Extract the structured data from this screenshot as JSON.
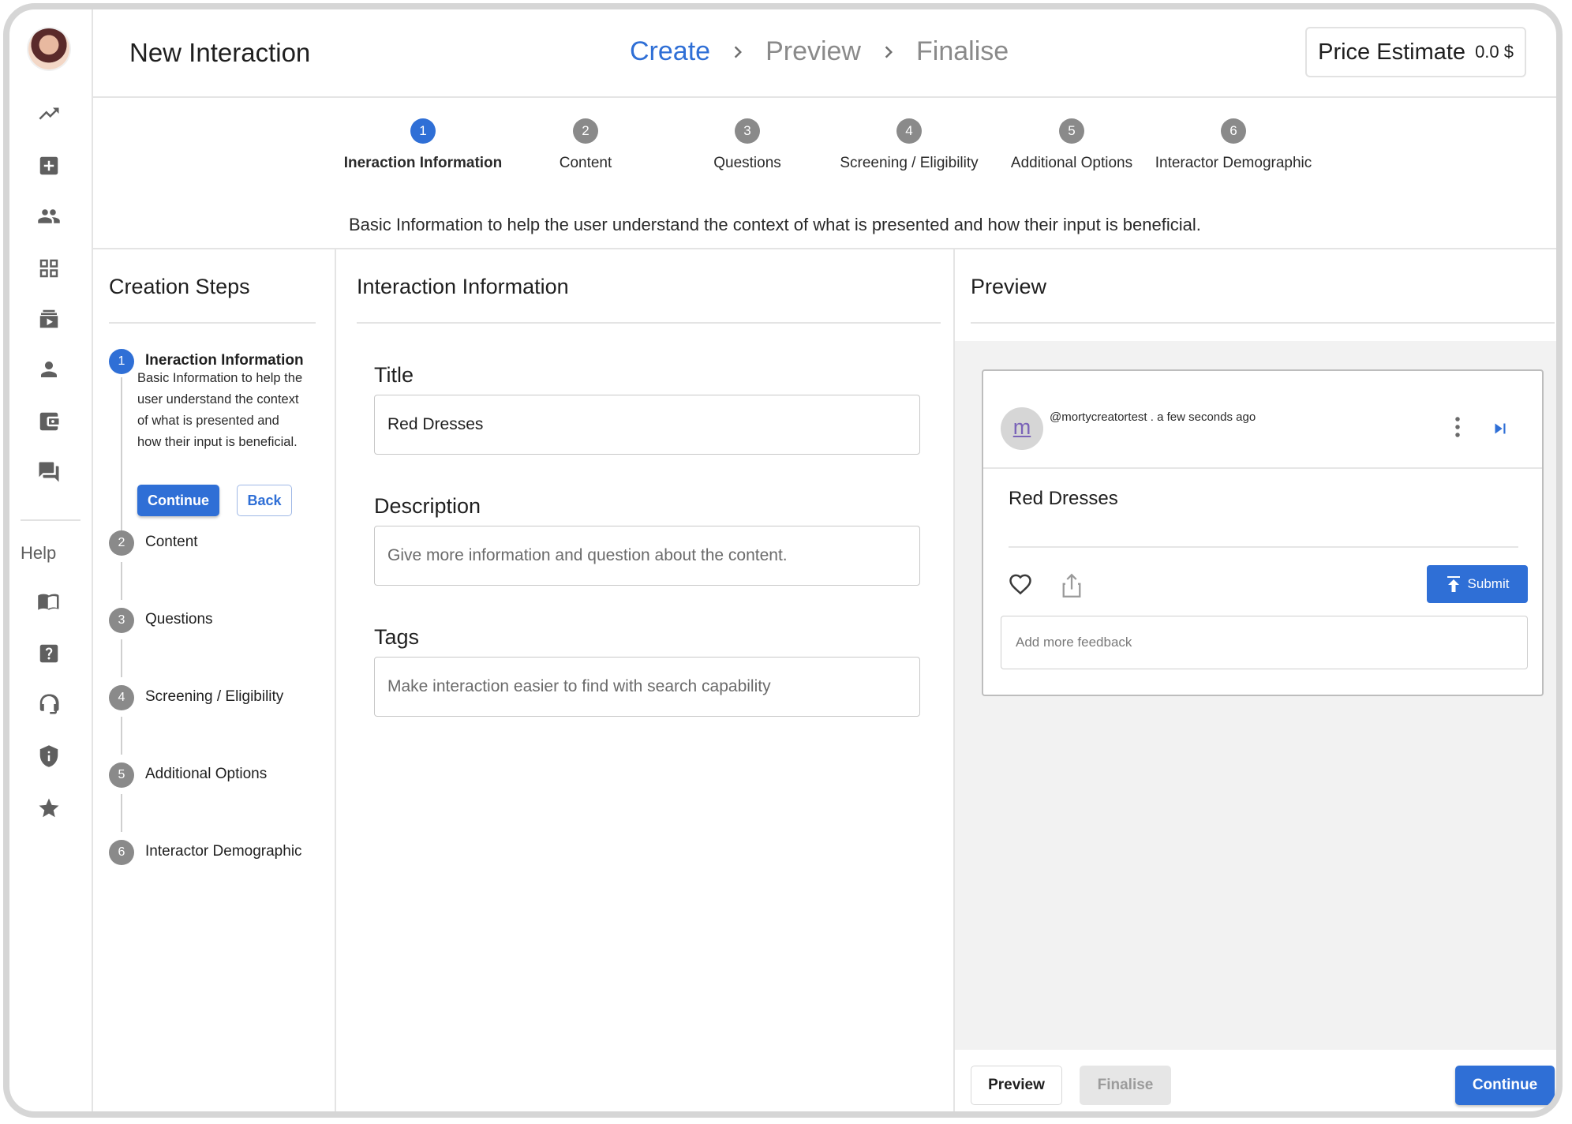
{
  "header": {
    "title": "New Interaction",
    "breadcrumbs": [
      "Create",
      "Preview",
      "Finalise"
    ],
    "active_crumb": 0,
    "price_label": "Price Estimate",
    "price_value": "0.0 $"
  },
  "stepper": {
    "steps": [
      {
        "num": "1",
        "label": "Ineraction Information"
      },
      {
        "num": "2",
        "label": "Content"
      },
      {
        "num": "3",
        "label": "Questions"
      },
      {
        "num": "4",
        "label": "Screening / Eligibility"
      },
      {
        "num": "5",
        "label": "Additional Options"
      },
      {
        "num": "6",
        "label": "Interactor Demographic"
      }
    ],
    "description": "Basic Information to help the user understand the context of what is presented and how their input is beneficial."
  },
  "sidebar": {
    "help_label": "Help",
    "icons": [
      "trending-up-icon",
      "add-box-icon",
      "people-icon",
      "grid-icon",
      "video-library-icon",
      "person-icon",
      "wallet-icon",
      "forum-icon"
    ],
    "help_icons": [
      "menu-book-icon",
      "help-icon",
      "support-agent-icon",
      "shield-icon",
      "star-icon"
    ]
  },
  "creation_steps": {
    "heading": "Creation Steps",
    "active_desc": "Basic Information to help the user understand the context of what is presented and how their input is beneficial.",
    "continue_label": "Continue",
    "back_label": "Back"
  },
  "form": {
    "heading": "Interaction Information",
    "title_label": "Title",
    "title_value": "Red Dresses",
    "description_label": "Description",
    "description_placeholder": "Give more information and question about the content.",
    "tags_label": "Tags",
    "tags_placeholder": "Make interaction easier to find with search capability"
  },
  "preview": {
    "heading": "Preview",
    "avatar_letter": "m",
    "meta": "@mortycreatortest . a few seconds ago",
    "card_title": "Red Dresses",
    "submit_label": "Submit",
    "feedback_placeholder": "Add more feedback"
  },
  "footer": {
    "preview_label": "Preview",
    "finalise_label": "Finalise",
    "continue_label": "Continue"
  },
  "colors": {
    "accent": "#2f6fd6",
    "inactive": "#8a8a8a"
  }
}
